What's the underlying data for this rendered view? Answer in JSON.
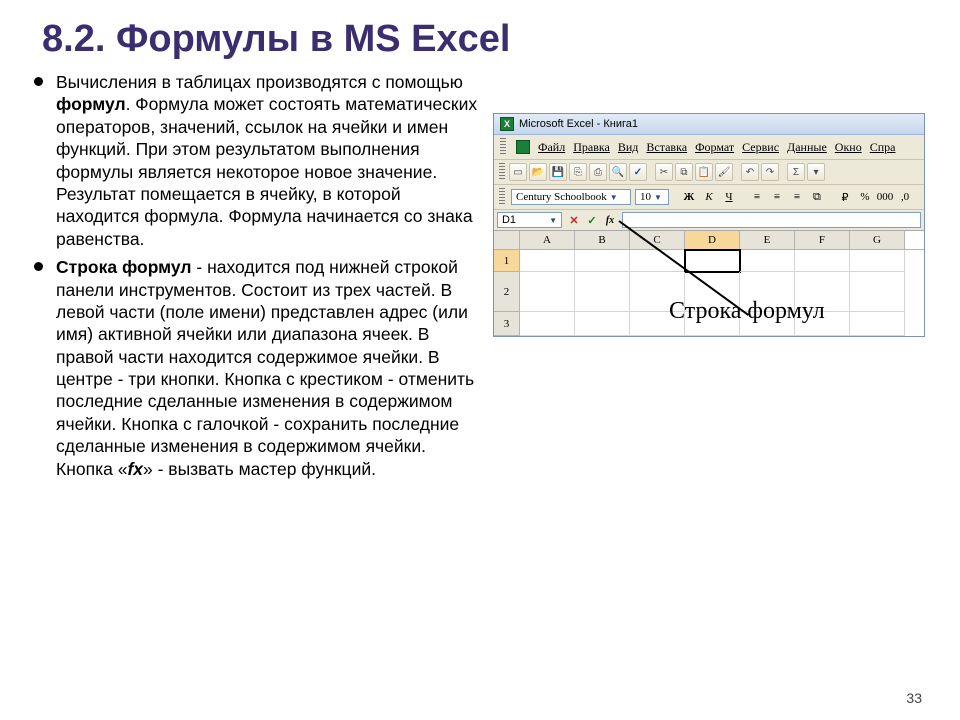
{
  "slide": {
    "title": "8.2. Формулы в MS Excel",
    "page_number": "33",
    "bullets": [
      {
        "html": "Вычисления в таблицах производятся с помощью <b>формул</b>. Формула может состоять математических операторов, значений, ссылок на ячейки и имен функций. При этом результатом выполнения формулы является некоторое новое значение. Результат помещается в ячейку, в которой находится формула. Формула начинается со знака равенства."
      },
      {
        "html": "<b>Строка формул</b> - находится под нижней строкой панели инструментов. Состоит из трех частей. В левой части (поле имени) представлен адрес (или имя) активной ячейки или диапазона ячеек. В правой части находится содержимое ячейки. В центре - три кнопки. Кнопка с крестиком - отменить последние сделанные изменения в содержимом ячейки. Кнопка с галочкой - сохранить последние сделанные изменения в содержимом ячейки. Кнопка «<b><i>fx</i></b>» - вызвать мастер функций."
      }
    ]
  },
  "excel": {
    "window_title": "Microsoft Excel - Книга1",
    "menus": [
      "Файл",
      "Правка",
      "Вид",
      "Вставка",
      "Формат",
      "Сервис",
      "Данные",
      "Окно",
      "Спра"
    ],
    "font_name": "Century Schoolbook",
    "font_size": "10",
    "format_buttons": {
      "bold": "Ж",
      "italic": "К",
      "underline": "Ч"
    },
    "name_box": "D1",
    "formula_buttons": {
      "cancel": "✕",
      "ok": "✓",
      "fx": "fx"
    },
    "columns": [
      "A",
      "B",
      "C",
      "D",
      "E",
      "F",
      "G"
    ],
    "rows": [
      "1",
      "2",
      "3"
    ],
    "active_cell": "D1",
    "annotation": "Строка формул",
    "currency_hint": "%",
    "pct_hint": "000",
    "dec_hint": ",0"
  }
}
